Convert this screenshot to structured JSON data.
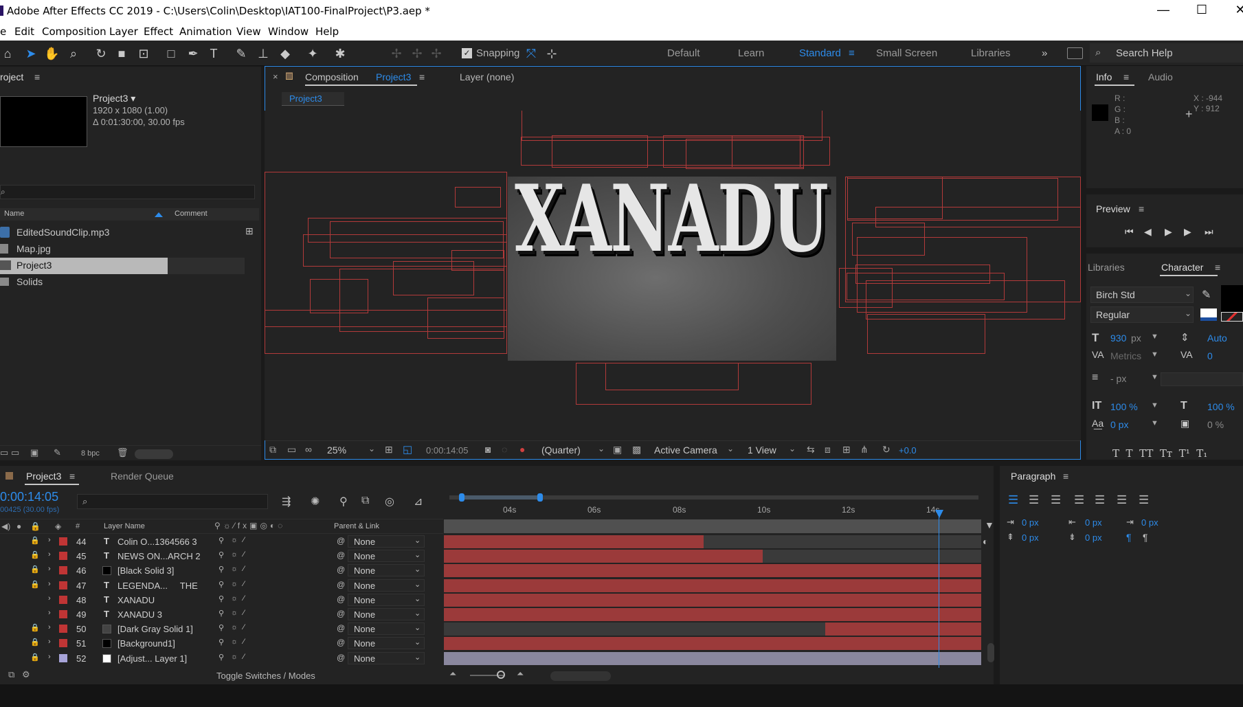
{
  "titlebar": {
    "title": "Adobe After Effects CC 2019 - C:\\Users\\Colin\\Desktop\\IAT100-FinalProject\\P3.aep *"
  },
  "menu": {
    "file": "e",
    "edit": "Edit",
    "composition": "Composition",
    "layer": "Layer",
    "effect": "Effect",
    "animation": "Animation",
    "view": "View",
    "window": "Window",
    "help": "Help"
  },
  "toolbar": {
    "snapping": "Snapping",
    "workspaces": [
      "Default",
      "Learn",
      "Standard",
      "Small Screen",
      "Libraries"
    ],
    "active_workspace": "Standard",
    "search_placeholder": "Search Help"
  },
  "project": {
    "tab": "roject",
    "comp_name": "Project3 ▾",
    "comp_size": "1920 x 1080 (1.00)",
    "comp_duration": "Δ 0:01:30:00, 30.00 fps",
    "col_name": "Name",
    "col_comment": "Comment",
    "items": [
      "EditedSoundClip.mp3",
      "Map.jpg",
      "Project3",
      "Solids"
    ],
    "bpc": "8 bpc"
  },
  "comp": {
    "tab_prefix": "Composition",
    "tab_name": "Project3",
    "layer_tab": "Layer  (none)",
    "crumb": "Project3",
    "title_text": "XANADU",
    "zoom": "25%",
    "timecode": "0:00:14:05",
    "resolution": "(Quarter)",
    "camera": "Active Camera",
    "views": "1 View",
    "exposure": "+0.0"
  },
  "info": {
    "tab": "Info",
    "audio_tab": "Audio",
    "r": "R :",
    "g": "G :",
    "b": "B :",
    "a": "A : 0",
    "x": "X : -944",
    "y": "Y : 912"
  },
  "preview": {
    "tab": "Preview"
  },
  "character": {
    "libraries_tab": "Libraries",
    "tab": "Character",
    "font": "Birch Std",
    "style": "Regular",
    "size": "930",
    "size_unit": "px",
    "leading": "Auto",
    "kerning": "Metrics",
    "tracking": "0",
    "stroke": "- px",
    "vscale": "100 %",
    "hscale": "100 %",
    "baseline": "0 px",
    "tsume": "0 %",
    "styles": "T  T  TT  Tт  T¹  T₁"
  },
  "timeline": {
    "tab": "Project3",
    "render_tab": "Render Queue",
    "timecode": "0:00:14:05",
    "frames": "00425 (30.00 fps)",
    "col_num": "#",
    "col_layer": "Layer Name",
    "col_parent": "Parent & Link",
    "ticks": [
      "04s",
      "06s",
      "08s",
      "10s",
      "12s",
      "14s"
    ],
    "toggle": "Toggle Switches / Modes",
    "layers": [
      {
        "num": "44",
        "type": "T",
        "name": "Colin O...1364566 3",
        "parent": "None",
        "color": "#c03535",
        "swatch": ""
      },
      {
        "num": "45",
        "type": "T",
        "name": "NEWS ON...ARCH 2",
        "parent": "None",
        "color": "#c03535",
        "swatch": ""
      },
      {
        "num": "46",
        "type": "",
        "name": "[Black Solid 3]",
        "parent": "None",
        "color": "#c03535",
        "swatch": "#000000"
      },
      {
        "num": "47",
        "type": "T",
        "name": "LEGENDA...     THE",
        "parent": "None",
        "color": "#c03535",
        "swatch": ""
      },
      {
        "num": "48",
        "type": "T",
        "name": "XANADU",
        "parent": "None",
        "color": "#c03535",
        "swatch": ""
      },
      {
        "num": "49",
        "type": "T",
        "name": "XANADU 3",
        "parent": "None",
        "color": "#c03535",
        "swatch": ""
      },
      {
        "num": "50",
        "type": "",
        "name": "[Dark Gray Solid 1]",
        "parent": "None",
        "color": "#c03535",
        "swatch": "#444444"
      },
      {
        "num": "51",
        "type": "",
        "name": "[Background1]",
        "parent": "None",
        "color": "#c03535",
        "swatch": "#000000"
      },
      {
        "num": "52",
        "type": "",
        "name": "[Adjust... Layer 1]",
        "parent": "None",
        "color": "#a7a4d8",
        "swatch": "#ffffff"
      }
    ]
  },
  "paragraph": {
    "tab": "Paragraph",
    "indent": "0 px"
  }
}
